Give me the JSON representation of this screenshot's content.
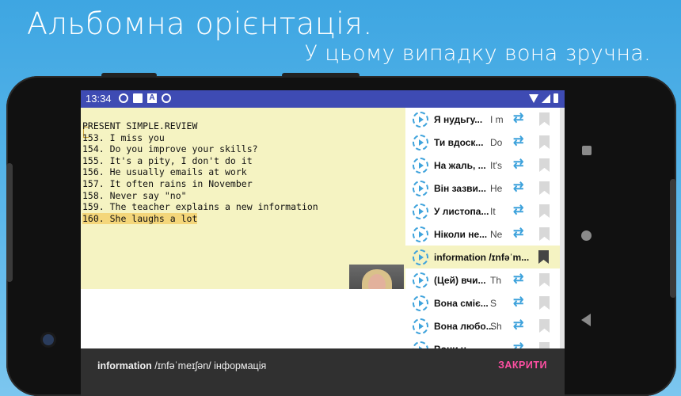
{
  "headline": "Альбомна орієнтація.",
  "subline": "У цьому випадку вона зручна.",
  "status": {
    "time": "13:34",
    "icons": [
      "gear-icon",
      "mail-icon",
      "a-icon",
      "circle-icon"
    ],
    "right_icons": [
      "wifi-icon",
      "signal-icon",
      "battery-icon"
    ]
  },
  "lesson": {
    "lines": [
      "PRESENT SIMPLE.REVIEW",
      "153. I miss you",
      "154. Do you improve your skills?",
      "155. It's a pity, I don't do it",
      "156. He usually emails at work",
      "157. It often rains in November",
      "158. Never say \"no\"",
      "159. The teacher explains a new information",
      "160. She laughs a lot"
    ],
    "highlight_color": "#f4d67a",
    "background_color": "#f5f3c2"
  },
  "phrases": [
    {
      "title": "Я нудьгу...",
      "sub": "I m",
      "selected": false
    },
    {
      "title": "Ти вдоск...",
      "sub": "Do",
      "selected": false
    },
    {
      "title": "На жаль, ...",
      "sub": "It's",
      "selected": false
    },
    {
      "title": "Він зазви...",
      "sub": "He",
      "selected": false
    },
    {
      "title": "У листопа...",
      "sub": "It",
      "selected": false
    },
    {
      "title": "Ніколи не...",
      "sub": "Ne",
      "selected": false
    },
    {
      "title": "information /ɪnfəˈm...",
      "sub": "",
      "selected": true
    },
    {
      "title": "(Цей) вчи...",
      "sub": "Th",
      "selected": false
    },
    {
      "title": "Вона сміє...",
      "sub": "S",
      "selected": false
    },
    {
      "title": "Вона любо...",
      "sub": "Sh",
      "selected": false
    },
    {
      "title": "Вони ч...",
      "sub": "",
      "selected": false
    }
  ],
  "bottom": {
    "word": "information",
    "translation": " /ɪnfəˈmeɪʃən/ інформація",
    "close_label": "ЗАКРИТИ"
  },
  "colors": {
    "statusbar": "#3e4bb3",
    "accent": "#3fa3dc",
    "close": "#ff4fa3"
  }
}
